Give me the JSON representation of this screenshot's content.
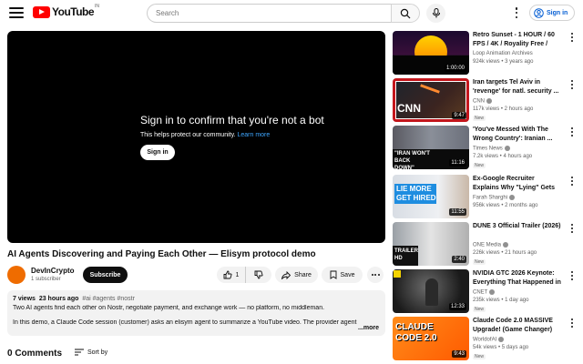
{
  "header": {
    "logo_text": "YouTube",
    "logo_country": "IN",
    "search_placeholder": "Search",
    "signin_label": "Sign in"
  },
  "player": {
    "title": "Sign in to confirm that you're not a bot",
    "subtitle": "This helps protect our community.",
    "learn_more": "Learn more",
    "signin_button": "Sign in"
  },
  "video": {
    "title": "AI Agents Discovering and Paying Each Other — Elisym protocol demo",
    "channel": "DevInCrypto",
    "subscribers": "1 subscriber",
    "subscribe_label": "Subscribe",
    "likes": "1",
    "share_label": "Share",
    "save_label": "Save"
  },
  "description": {
    "views": "7 views",
    "age": "23 hours ago",
    "tags": "#ai #agents #nostr",
    "line1": "Two AI agents find each other on Nostr, negotiate payment, and exchange work — no platform, no middleman.",
    "line2": "In this demo, a Claude Code session (customer) asks an elisym agent to summarize a YouTube video. The provider agent",
    "more": "...more"
  },
  "comments": {
    "count": "0 Comments",
    "sort_label": "Sort by"
  },
  "recommendations": [
    {
      "title": "Retro Sunset - 1 HOUR / 60 FPS / 4K / Royality Free / Free ...",
      "channel": "Loop Animation Archives",
      "verified": false,
      "stats": "924k views • 3 years ago",
      "duration": "1:00:00",
      "new": ""
    },
    {
      "title": "Iran targets Tel Aviv in 'revenge' for natl. security ...",
      "channel": "CNN",
      "verified": true,
      "stats": "117k views • 2 hours ago",
      "duration": "9:47",
      "new": "New",
      "thumb_text": "CNN"
    },
    {
      "title": "'You've Messed With The Wrong Country': Iranian ...",
      "channel": "Times News",
      "verified": true,
      "stats": "7.2k views • 4 hours ago",
      "duration": "11:16",
      "new": "New",
      "thumb_text": "\"IRAN WON'T BACK DOWN\""
    },
    {
      "title": "Ex-Google Recruiter Explains Why \"Lying\" Gets You Hired",
      "channel": "Farah Sharghi",
      "verified": true,
      "stats": "956k views • 2 months ago",
      "duration": "11:55",
      "new": "",
      "thumb_text": "LIE MORE GET HIRED"
    },
    {
      "title": "DUNE 3 Official Trailer (2026)",
      "channel": "ONE Media",
      "verified": true,
      "stats": "226k views • 21 hours ago",
      "duration": "2:40",
      "new": "New",
      "thumb_text": "TRAILER HD"
    },
    {
      "title": "NVIDIA GTC 2026 Keynote: Everything That Happened in ...",
      "channel": "CNET",
      "verified": true,
      "stats": "235k views • 1 day ago",
      "duration": "12:33",
      "new": "New"
    },
    {
      "title": "Claude Code 2.0 MASSIVE Upgrade! (Game Changer)",
      "channel": "WorldofAI",
      "verified": true,
      "stats": "54k views • 5 days ago",
      "duration": "9:43",
      "new": "New",
      "thumb_text": "CLAUDE CODE 2.0"
    }
  ],
  "colors": {
    "brand_red": "#ff0000",
    "link_blue": "#065fd4",
    "player_link": "#3ea6ff"
  }
}
